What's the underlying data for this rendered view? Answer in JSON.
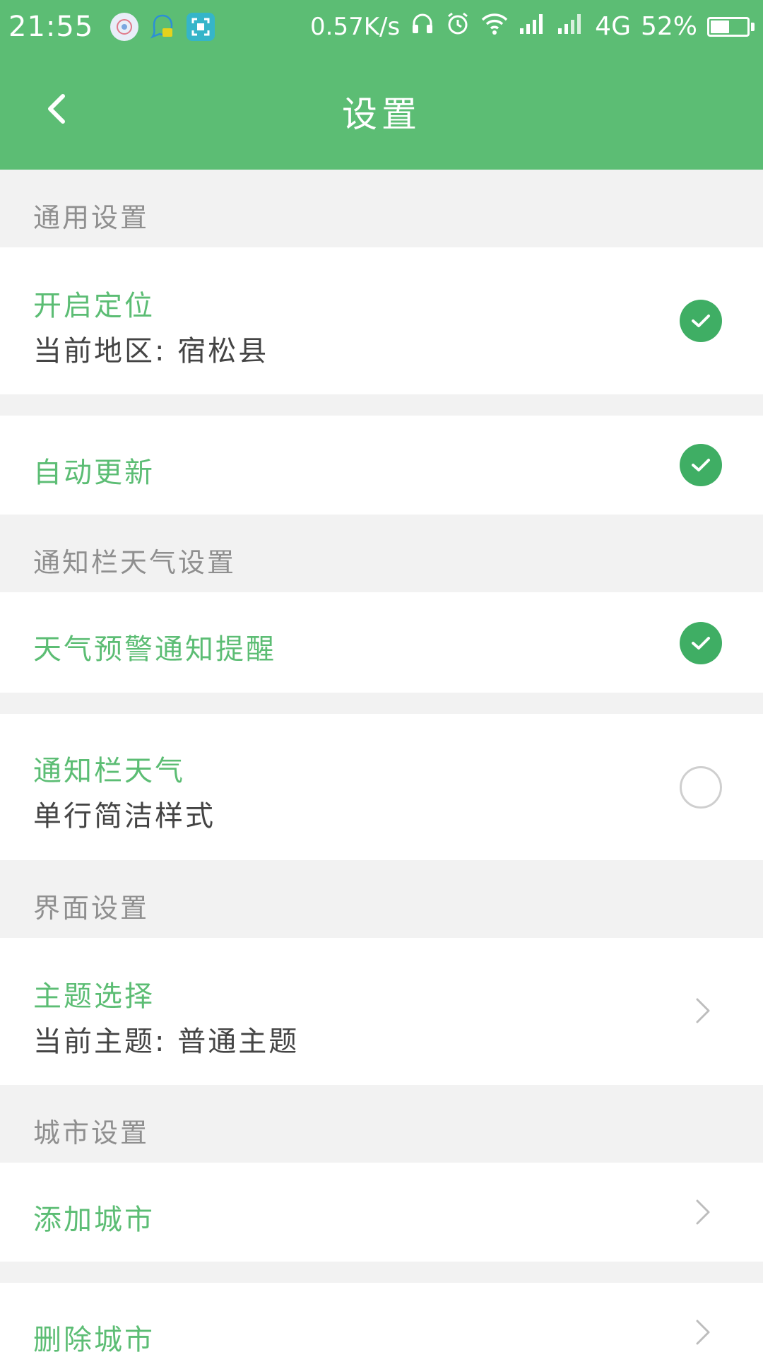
{
  "status_bar": {
    "time": "21:55",
    "net_speed": "0.57K/s",
    "network_type": "4G",
    "battery_percent": "52%",
    "battery_level": 0.52,
    "icons": [
      "app-icon-1",
      "chat-bubble-icon",
      "scan-icon",
      "headphones-icon",
      "alarm-icon",
      "wifi-icon",
      "signal-icon",
      "signal-icon-2",
      "battery-icon"
    ]
  },
  "toolbar": {
    "title": "设置",
    "back_icon": "chevron-left-icon"
  },
  "colors": {
    "accent": "#5cbd74",
    "check": "#3fae64",
    "section_text": "#8f8f8f",
    "subtitle_text": "#444444",
    "background": "#f2f2f2"
  },
  "sections": {
    "general": {
      "header": "通用设置",
      "location": {
        "title": "开启定位",
        "subtitle": "当前地区: 宿松县",
        "checked": true
      },
      "auto_update": {
        "title": "自动更新",
        "checked": true
      }
    },
    "notification": {
      "header": "通知栏天气设置",
      "warning": {
        "title": "天气预警通知提醒",
        "checked": true
      },
      "notif_weather": {
        "title": "通知栏天气",
        "subtitle": "单行简洁样式",
        "checked": false
      }
    },
    "interface": {
      "header": "界面设置",
      "theme": {
        "title": "主题选择",
        "subtitle": "当前主题: 普通主题"
      }
    },
    "city": {
      "header": "城市设置",
      "add": {
        "title": "添加城市"
      },
      "delete": {
        "title": "删除城市"
      }
    }
  }
}
